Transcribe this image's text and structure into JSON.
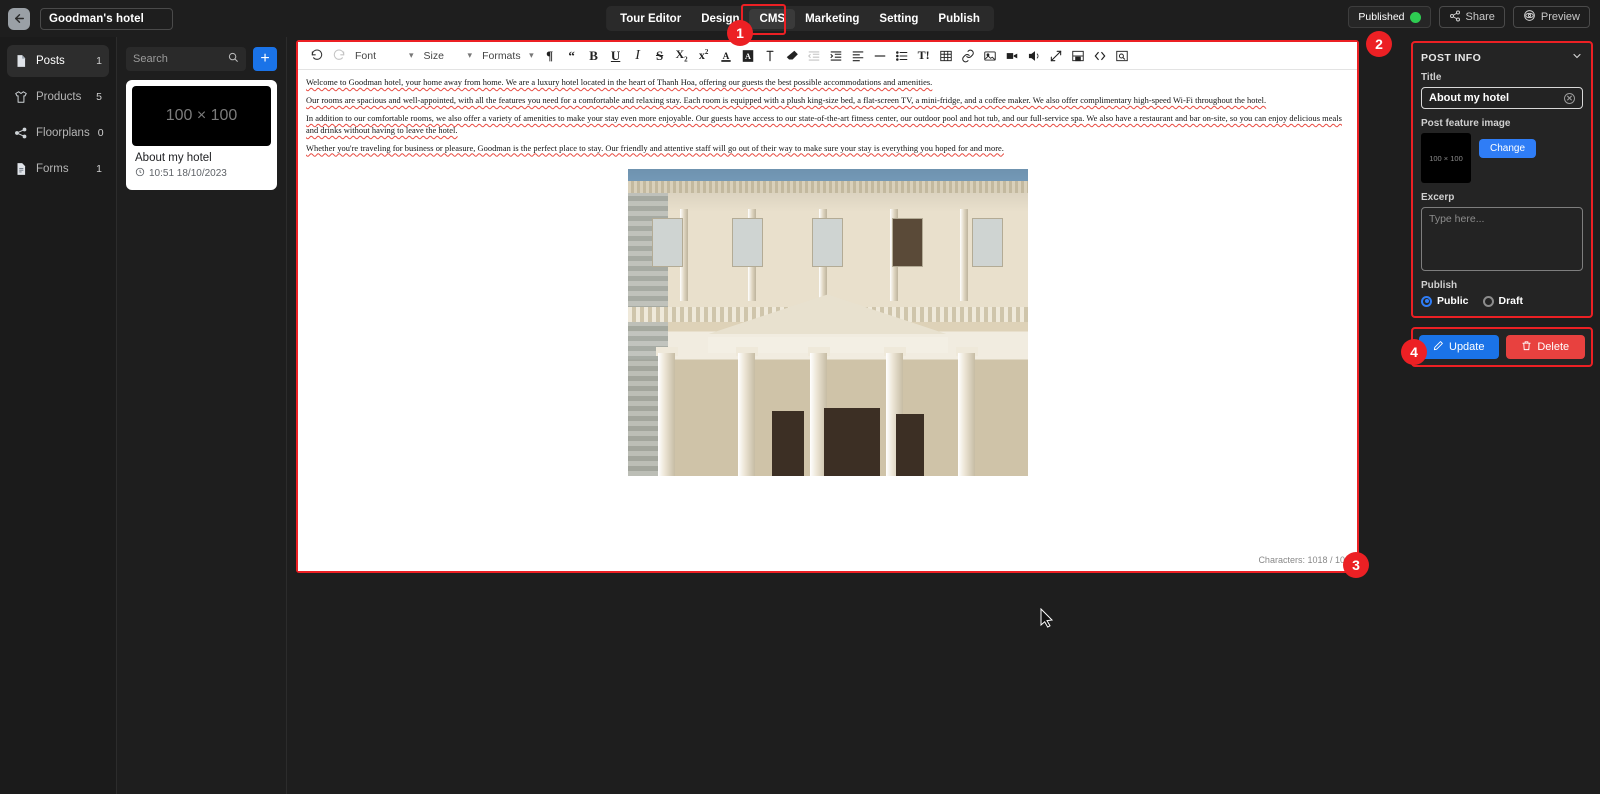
{
  "topbar": {
    "back_icon": "arrow-left-icon",
    "site_name": "Goodman's hotel",
    "tabs": [
      {
        "label": "Tour Editor",
        "active": false
      },
      {
        "label": "Design",
        "active": false
      },
      {
        "label": "CMS",
        "active": true
      },
      {
        "label": "Marketing",
        "active": false
      },
      {
        "label": "Setting",
        "active": false
      },
      {
        "label": "Publish",
        "active": false
      }
    ],
    "published_label": "Published",
    "share_label": "Share",
    "preview_label": "Preview",
    "published_dot_color": "#2ecc52"
  },
  "sidebar": {
    "items": [
      {
        "label": "Posts",
        "count": "1",
        "icon": "document-icon",
        "active": true
      },
      {
        "label": "Products",
        "count": "5",
        "icon": "tshirt-icon",
        "active": false
      },
      {
        "label": "Floorplans",
        "count": "0",
        "icon": "floorplan-icon",
        "active": false
      },
      {
        "label": "Forms",
        "count": "1",
        "icon": "form-icon",
        "active": false
      }
    ]
  },
  "list_column": {
    "search_placeholder": "Search",
    "search_icon": "search-icon",
    "add_button_label": "+",
    "cards": [
      {
        "thumb_label": "100 × 100",
        "title": "About my hotel",
        "time": "10:51 18/10/2023",
        "clock_icon": "clock-icon"
      }
    ]
  },
  "editor": {
    "toolbar": {
      "undo": "undo-icon",
      "redo": "redo-icon",
      "font_label": "Font",
      "size_label": "Size",
      "formats_label": "Formats",
      "buttons": [
        "paragraph-icon",
        "blockquote-icon",
        "bold-icon",
        "underline-icon",
        "italic-icon",
        "strikethrough-icon",
        "subscript-icon",
        "superscript-icon",
        "text-color-icon",
        "background-color-icon",
        "clear-format-icon",
        "eraser-icon",
        "outdent-icon",
        "indent-icon",
        "align-icon",
        "horizontal-rule-icon",
        "bullet-list-icon",
        "special-char-icon",
        "table-icon",
        "link-icon",
        "image-icon",
        "video-icon",
        "audio-icon",
        "fullscreen-icon",
        "page-break-icon",
        "source-code-icon",
        "preview-icon"
      ]
    },
    "paragraphs": [
      "Welcome to Goodman hotel, your home away from home. We are a luxury hotel located in the heart of Thanh Hoa, offering our guests the best possible accommodations and amenities.",
      "Our rooms are spacious and well-appointed, with all the features you need for a comfortable and relaxing stay. Each room is equipped with a plush king-size bed, a flat-screen TV, a mini-fridge, and a coffee maker. We also offer complimentary high-speed Wi-Fi throughout the hotel.",
      "In addition to our comfortable rooms, we also offer a variety of amenities to make your stay even more enjoyable. Our guests have access to our state-of-the-art fitness center, our outdoor pool and hot tub, and our full-service spa. We also have a restaurant and bar on-site, so you can enjoy delicious meals and drinks without having to leave the hotel.",
      "Whether you're traveling for business or pleasure, Goodman is the perfect place to stay. Our friendly and attentive staff will go out of their way to make sure your stay is everything you hoped for and more."
    ],
    "image_alt": "neoclassical-building-photo",
    "character_count": "Characters: 1018 / 10"
  },
  "right_panel": {
    "section_title": "POST INFO",
    "collapse_icon": "chevron-down-icon",
    "title_label": "Title",
    "title_value": "About my hotel",
    "clear_icon": "clear-icon",
    "feature_image_label": "Post feature image",
    "feature_image_placeholder": "100 × 100",
    "change_button": "Change",
    "excerp_label": "Excerp",
    "excerp_placeholder": "Type here...",
    "publish_label": "Publish",
    "radios": [
      {
        "label": "Public",
        "selected": true
      },
      {
        "label": "Draft",
        "selected": false
      }
    ],
    "update_button": "Update",
    "update_icon": "pencil-icon",
    "delete_button": "Delete",
    "delete_icon": "trash-icon",
    "accent_blue": "#1a73e8",
    "accent_red": "#e8413f"
  },
  "annotations": {
    "badges": [
      "1",
      "2",
      "3",
      "4"
    ],
    "highlight_color": "#ec2024"
  }
}
